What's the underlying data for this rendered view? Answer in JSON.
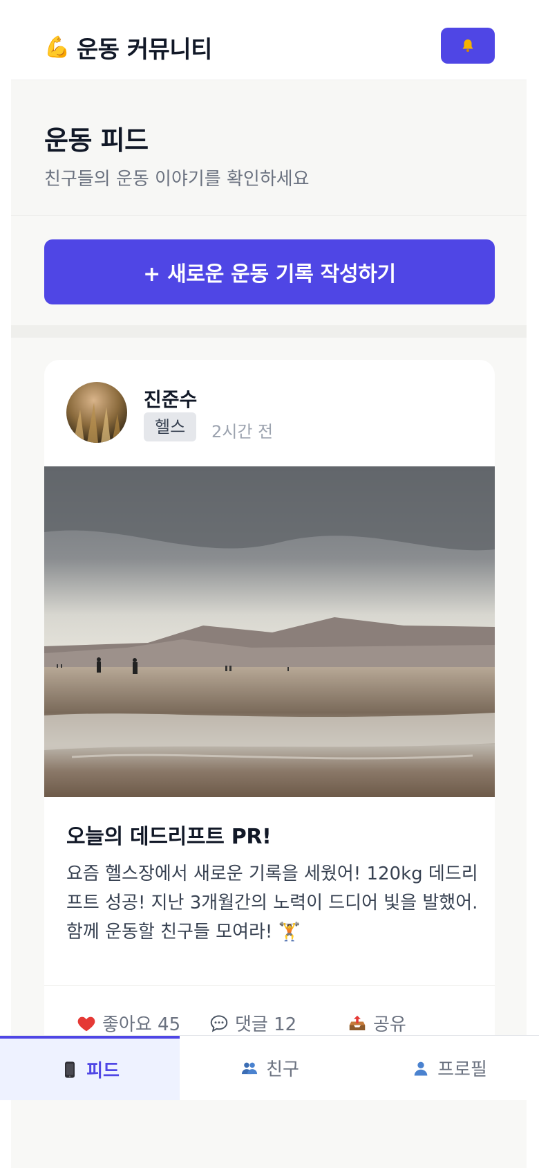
{
  "header": {
    "brand_emoji": "💪",
    "title": "운동 커뮤니티",
    "bell_icon": "bell-icon"
  },
  "section": {
    "title": "운동 피드",
    "subtitle": "친구들의 운동 이야기를 확인하세요"
  },
  "new_post_button": "+ 새로운 운동 기록 작성하기",
  "post": {
    "author": "진준수",
    "tag": "헬스",
    "time": "2시간 전",
    "title": "오늘의 데드리프트 PR!",
    "body": "요즘 헬스장에서 새로운 기록을 세웠어! 120kg 데드리프트 성공! 지난 3개월간의 노력이 드디어 빛을 발했어. 함께 운동할 친구들 모여라! 🏋",
    "actions": {
      "like_label": "좋아요 45",
      "comment_label": "댓글 12",
      "share_label": "공유"
    }
  },
  "nav": {
    "items": [
      {
        "label": "피드",
        "icon": "phone-icon",
        "active": true
      },
      {
        "label": "친구",
        "icon": "friends-icon",
        "active": false
      },
      {
        "label": "프로필",
        "icon": "profile-icon",
        "active": false
      }
    ]
  },
  "colors": {
    "accent": "#4f46e5",
    "accent_soft": "#eef2ff",
    "like_red": "#e53935"
  }
}
